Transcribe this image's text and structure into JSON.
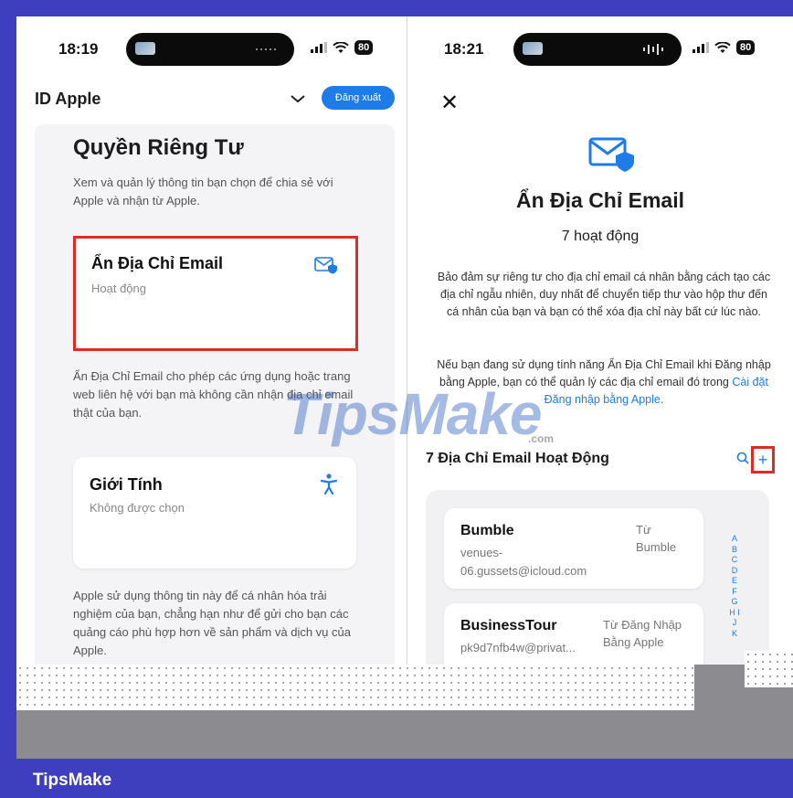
{
  "left_phone": {
    "status": {
      "time": "18:19",
      "battery": "80"
    },
    "topbar": {
      "title": "ID Apple",
      "logout_label": "Đăng xuất"
    },
    "heading": "Quyền Riêng Tư",
    "intro": "Xem và quản lý thông tin bạn chọn để chia sẻ với Apple và nhận từ Apple.",
    "hide_email_card": {
      "title": "Ẩn Địa Chỉ Email",
      "status": "Hoạt động",
      "icon": "envelope-shield-icon"
    },
    "hide_email_desc": "Ẩn Địa Chỉ Email cho phép các ứng dụng hoặc trang web liên hệ với bạn mà không cần nhận địa chỉ email thật của bạn.",
    "gender_card": {
      "title": "Giới Tính",
      "value": "Không được chọn",
      "icon": "accessibility-icon"
    },
    "footer_desc": "Apple sử dụng thông tin này để cá nhân hóa trải nghiệm của bạn, chẳng hạn như để gửi cho bạn các quảng cáo phù hợp hơn về sản phẩm và dịch vụ của Apple."
  },
  "right_phone": {
    "status": {
      "time": "18:21",
      "battery": "80"
    },
    "title": "Ẩn Địa Chỉ Email",
    "count": "7 hoạt động",
    "para1": "Bảo đảm sự riêng tư cho địa chỉ email cá nhân bằng cách tạo các địa chỉ ngẫu nhiên, duy nhất để chuyển tiếp thư vào hộp thư đến cá nhân của bạn và bạn có thể xóa địa chỉ này bất cứ lúc nào.",
    "para2_prefix": "Nếu bạn đang sử dụng tính năng Ẩn Địa Chỉ Email khi Đăng nhập bằng Apple, bạn có thể quản lý các địa chỉ email đó trong",
    "para2_link": "Cài đặt Đăng nhập bằng Apple.",
    "section_title": "7 Địa Chỉ Email Hoạt Động",
    "plus_label": "+",
    "emails": [
      {
        "name": "Bumble",
        "address_line1": "venues-",
        "address_line2": "06.gussets@icloud.com",
        "source_line1": "Từ",
        "source_line2": "Bumble"
      },
      {
        "name": "BusinessTour",
        "address_line1": "pk9d7nfb4w@privat...",
        "address_line2": "",
        "source_line1": "Từ Đăng Nhập",
        "source_line2": "Bằng Apple"
      }
    ],
    "alphabet": "A B C D E F G H I J K"
  },
  "watermark": {
    "text": "TipsMake",
    "suffix": ".com"
  },
  "brand": "TipsMake",
  "colors": {
    "accent": "#1e7ce8",
    "highlight": "#e02b22",
    "frame": "#3e3fbe"
  }
}
